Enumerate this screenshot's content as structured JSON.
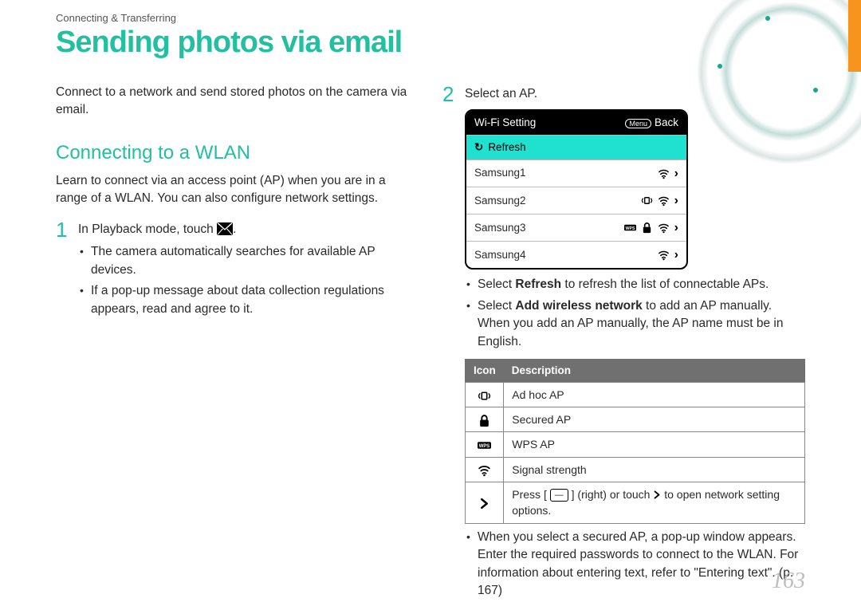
{
  "breadcrumb": "Connecting & Transferring",
  "title": "Sending photos via email",
  "intro": "Connect to a network and send stored photos on the camera via email.",
  "section_heading": "Connecting to a WLAN",
  "section_intro": "Learn to connect via an access point (AP) when you are in a range of a WLAN. You can also configure network settings.",
  "step1": {
    "num": "1",
    "text_a": "In Playback mode, touch ",
    "text_b": ".",
    "bullets": [
      "The camera automatically searches for available AP devices.",
      "If a pop-up message about data collection regulations appears, read and agree to it."
    ]
  },
  "step2": {
    "num": "2",
    "text": "Select an AP.",
    "wifi": {
      "title": "Wi-Fi Setting",
      "menu": "Menu",
      "back": "Back",
      "refresh": "Refresh",
      "aps": [
        {
          "name": "Samsung1",
          "adhoc": false,
          "wps": false,
          "lock": false
        },
        {
          "name": "Samsung2",
          "adhoc": true,
          "wps": false,
          "lock": false
        },
        {
          "name": "Samsung3",
          "adhoc": false,
          "wps": true,
          "lock": true
        },
        {
          "name": "Samsung4",
          "adhoc": false,
          "wps": false,
          "lock": false
        }
      ]
    },
    "bullets": [
      {
        "pre": "Select ",
        "bold": "Refresh",
        "post": " to refresh the list of connectable APs."
      },
      {
        "pre": "Select ",
        "bold": "Add wireless network",
        "post": " to add an AP manually. When you add an AP manually, the AP name must be in English."
      }
    ],
    "icon_table": {
      "headers": [
        "Icon",
        "Description"
      ],
      "rows": [
        {
          "icon": "adhoc",
          "desc": "Ad hoc AP"
        },
        {
          "icon": "lock",
          "desc": "Secured AP"
        },
        {
          "icon": "wps",
          "desc": "WPS AP"
        },
        {
          "icon": "signal",
          "desc": "Signal strength"
        },
        {
          "icon": "chevron",
          "desc_pre": "Press [ ",
          "desc_btn": "—",
          "desc_mid": " ] (right) or touch ",
          "desc_post": " to open network setting options."
        }
      ]
    },
    "tail_bullet": "When you select a secured AP, a pop-up window appears. Enter the required passwords to connect to the WLAN. For information about entering text, refer to \"Entering text\". (p. 167)"
  },
  "page_number": "163"
}
